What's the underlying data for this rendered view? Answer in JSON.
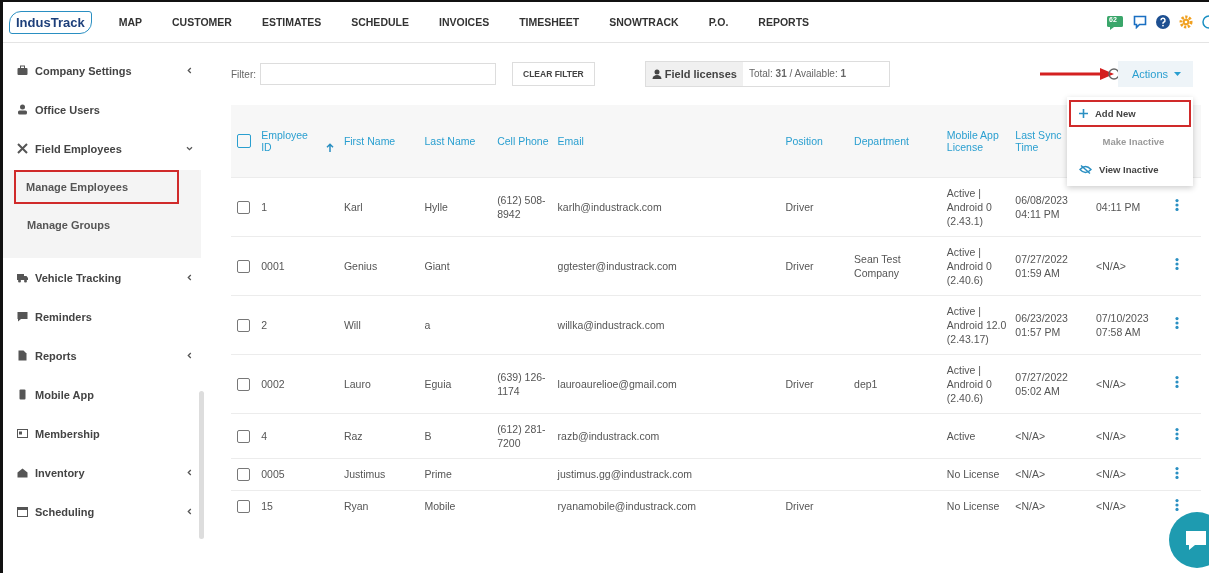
{
  "navbar": {
    "logo": "IndusTrack",
    "items": [
      {
        "label": "MAP"
      },
      {
        "label": "CUSTOMER"
      },
      {
        "label": "ESTIMATES"
      },
      {
        "label": "SCHEDULE"
      },
      {
        "label": "INVOICES"
      },
      {
        "label": "TIMESHEET"
      },
      {
        "label": "SNOWTRACK"
      },
      {
        "label": "P.O."
      },
      {
        "label": "REPORTS"
      }
    ],
    "notification_badge": "62"
  },
  "sidebar": {
    "items": [
      {
        "label": "Company Settings",
        "kind": "group",
        "expanded": false
      },
      {
        "label": "Office Users",
        "kind": "link"
      },
      {
        "label": "Field Employees",
        "kind": "group",
        "expanded": true,
        "children": [
          {
            "label": "Manage Employees",
            "highlighted": true
          },
          {
            "label": "Manage Groups",
            "highlighted": false
          }
        ]
      },
      {
        "label": "Vehicle Tracking",
        "kind": "group",
        "expanded": false
      },
      {
        "label": "Reminders",
        "kind": "link"
      },
      {
        "label": "Reports",
        "kind": "group",
        "expanded": false
      },
      {
        "label": "Mobile App",
        "kind": "link"
      },
      {
        "label": "Membership",
        "kind": "link"
      },
      {
        "label": "Inventory",
        "kind": "group",
        "expanded": false
      },
      {
        "label": "Scheduling",
        "kind": "group",
        "expanded": false
      }
    ]
  },
  "toolbar": {
    "filter_label": "Filter:",
    "clear_filter": "CLEAR FILTER",
    "field_licenses": "Field licenses",
    "license_summary": "Total: **31** / Available: **1**",
    "actions": "Actions"
  },
  "actions_menu": {
    "items": [
      {
        "label": "Add New",
        "disabled": false,
        "highlighted": true
      },
      {
        "label": "Make Inactive",
        "disabled": true,
        "highlighted": false
      },
      {
        "label": "View Inactive",
        "disabled": false,
        "highlighted": false
      }
    ]
  },
  "table": {
    "header_checked": false,
    "columns": [
      {
        "label": "Employee ID",
        "sorted": true
      },
      {
        "label": "First Name",
        "sorted": false
      },
      {
        "label": "Last Name",
        "sorted": false
      },
      {
        "label": "Cell Phone",
        "sorted": false
      },
      {
        "label": "Email",
        "sorted": false
      },
      {
        "label": "Position",
        "sorted": false
      },
      {
        "label": "Department",
        "sorted": false
      },
      {
        "label": "Mobile App License",
        "sorted": false
      },
      {
        "label": "Last Sync Time",
        "sorted": false
      }
    ],
    "rows": [
      {
        "checked": false,
        "cells": [
          "1",
          "Karl",
          "Hylle",
          "(612) 508-8942",
          "karlh@industrack.com",
          "Driver",
          "",
          "Active | Android 0 (2.43.1)",
          "06/08/2023 04:11 PM",
          "04:11 PM"
        ]
      },
      {
        "checked": false,
        "cells": [
          "0001",
          "Genius",
          "Giant",
          "",
          "ggtester@industrack.com",
          "Driver",
          "Sean Test Company",
          "Active | Android 0 (2.40.6)",
          "07/27/2022 01:59 AM",
          "<N/A>"
        ]
      },
      {
        "checked": false,
        "cells": [
          "2",
          "Will",
          "a",
          "",
          "willka@industrack.com",
          "",
          "",
          "Active | Android 12.0 (2.43.17)",
          "06/23/2023 01:57 PM",
          "07/10/2023 07:58 AM"
        ]
      },
      {
        "checked": false,
        "cells": [
          "0002",
          "Lauro",
          "Eguia",
          "(639) 126-1174",
          "lauroaurelioe@gmail.com",
          "Driver",
          "dep1",
          "Active | Android 0 (2.40.6)",
          "07/27/2022 05:02 AM",
          "<N/A>"
        ]
      },
      {
        "checked": false,
        "cells": [
          "4",
          "Raz",
          "B",
          "(612) 281-7200",
          "razb@industrack.com",
          "",
          "",
          "Active",
          "<N/A>",
          "<N/A>"
        ]
      },
      {
        "checked": false,
        "cells": [
          "0005",
          "Justimus",
          "Prime",
          "",
          "justimus.gg@industrack.com",
          "",
          "",
          "No License",
          "<N/A>",
          "<N/A>"
        ]
      },
      {
        "checked": false,
        "cells": [
          "15",
          "Ryan",
          "Mobile",
          "",
          "ryanamobile@industrack.com",
          "Driver",
          "",
          "No License",
          "<N/A>",
          "<N/A>"
        ]
      }
    ]
  }
}
